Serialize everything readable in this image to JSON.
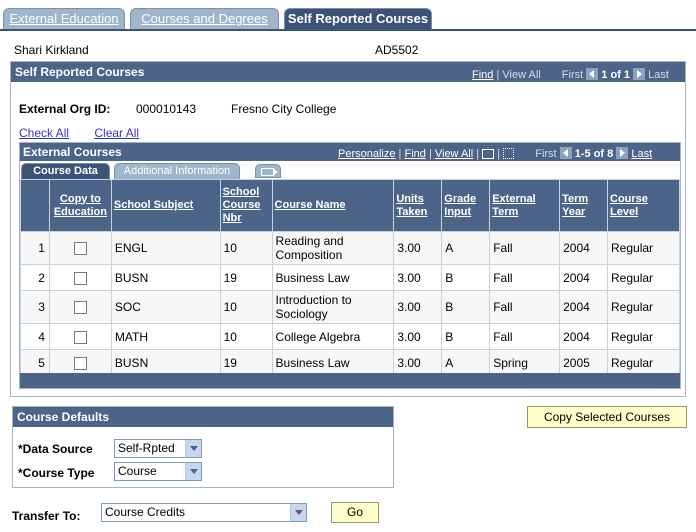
{
  "tabs": [
    "External Education",
    "Courses and Degrees",
    "Self Reported Courses"
  ],
  "person": {
    "name": "Shari Kirkland",
    "id": "AD5502"
  },
  "main": {
    "title": "Self Reported Courses",
    "nav": {
      "find": "Find",
      "view_all": "View All",
      "first": "First",
      "count": "1 of 1",
      "last": "Last"
    }
  },
  "org": {
    "label": "External Org ID:",
    "id": "000010143",
    "name": "Fresno City College"
  },
  "links": {
    "check_all": "Check All",
    "clear_all": "Clear All"
  },
  "grid": {
    "title": "External Courses",
    "nav": {
      "personalize": "Personalize",
      "find": "Find",
      "view_all": "View All",
      "first": "First",
      "count": "1-5 of 8",
      "last": "Last"
    },
    "tabs": [
      "Course Data",
      "Additional Information"
    ],
    "columns": [
      "Copy to Education",
      "School Subject",
      "School Course Nbr",
      "Course Name",
      "Units Taken",
      "Grade Input",
      "External Term",
      "Term Year",
      "Course Level"
    ],
    "rows": [
      {
        "n": "1",
        "subject": "ENGL",
        "nbr": "10",
        "name": "Reading and Composition",
        "units": "3.00",
        "grade": "A",
        "term": "Fall",
        "year": "2004",
        "level": "Regular"
      },
      {
        "n": "2",
        "subject": "BUSN",
        "nbr": "19",
        "name": "Business Law",
        "units": "3.00",
        "grade": "B",
        "term": "Fall",
        "year": "2004",
        "level": "Regular"
      },
      {
        "n": "3",
        "subject": "SOC",
        "nbr": "10",
        "name": "Introduction to Sociology",
        "units": "3.00",
        "grade": "B",
        "term": "Fall",
        "year": "2004",
        "level": "Regular"
      },
      {
        "n": "4",
        "subject": "MATH",
        "nbr": "10",
        "name": "College Algebra",
        "units": "3.00",
        "grade": "B",
        "term": "Fall",
        "year": "2004",
        "level": "Regular"
      },
      {
        "n": "5",
        "subject": "BUSN",
        "nbr": "19",
        "name": "Business Law",
        "units": "3.00",
        "grade": "A",
        "term": "Spring",
        "year": "2005",
        "level": "Regular"
      }
    ]
  },
  "defaults": {
    "title": "Course Defaults",
    "data_source_label": "*Data Source",
    "data_source_value": "Self-Rpted",
    "course_type_label": "*Course Type",
    "course_type_value": "Course"
  },
  "copy_button": "Copy Selected Courses",
  "transfer": {
    "label": "Transfer To:",
    "value": "Course Credits",
    "go": "Go"
  }
}
